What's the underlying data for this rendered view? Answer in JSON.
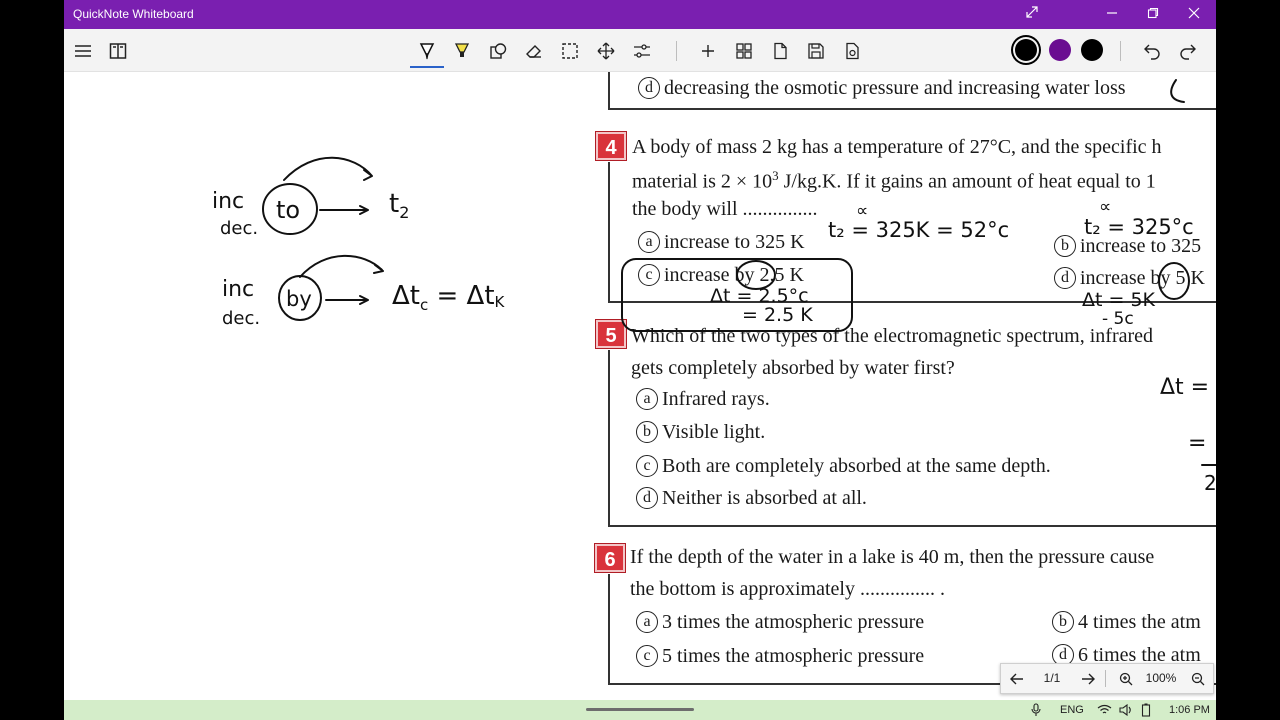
{
  "window": {
    "title": "QuickNote Whiteboard"
  },
  "toolbar": {
    "left_icons": [
      "hamburger-menu-icon",
      "book-icon"
    ],
    "tools": [
      "pen-icon",
      "highlighter-icon",
      "shape-icon",
      "eraser-icon",
      "lasso-select-icon",
      "move-icon",
      "adjust-icon"
    ],
    "actions": [
      "add-page-icon",
      "grid-icon",
      "page-icon",
      "save-icon",
      "export-icon"
    ],
    "active_tool": "pen",
    "pen_colors": [
      "#000000",
      "#6a0d91",
      "#000000"
    ],
    "history": [
      "undo-icon",
      "redo-icon"
    ]
  },
  "colors": {
    "titlebar": "#7a1fb0",
    "question_badge": "#d9333b",
    "taskbar": "#d4edc9"
  },
  "worksheet": {
    "prev_option": {
      "letter": "d",
      "text": "decreasing the osmotic pressure and increasing water loss"
    },
    "q4": {
      "number": "4",
      "line1": "A body of mass 2 kg has a temperature of 27°C, and the specific h",
      "line2_pre": "material is 2 × 10",
      "line2_sup": "3",
      "line2_post": " J/kg.K. If it gains an amount of heat equal to 1",
      "line3": "the body will ...............",
      "options": [
        {
          "letter": "a",
          "text": "increase to 325 K"
        },
        {
          "letter": "b",
          "text": "increase to 325"
        },
        {
          "letter": "c",
          "text": "increase by 2.5 K"
        },
        {
          "letter": "d",
          "text": "increase by 5 K"
        }
      ]
    },
    "q5": {
      "number": "5",
      "line1": "Which of the two types of the electromagnetic spectrum, infrared",
      "line2": "gets completely absorbed by water first?",
      "options": [
        {
          "letter": "a",
          "text": "Infrared rays."
        },
        {
          "letter": "b",
          "text": "Visible light."
        },
        {
          "letter": "c",
          "text": "Both are completely absorbed at the same depth."
        },
        {
          "letter": "d",
          "text": "Neither is absorbed at all."
        }
      ]
    },
    "q6": {
      "number": "6",
      "line1": "If the depth of the water in a lake is 40 m, then the pressure cause",
      "line2": "the bottom is approximately ............... .",
      "options": [
        {
          "letter": "a",
          "text": "3 times the atmospheric pressure"
        },
        {
          "letter": "b",
          "text": "4 times the atm"
        },
        {
          "letter": "c",
          "text": "5 times the atmospheric pressure"
        },
        {
          "letter": "d",
          "text": "6 times the atm"
        }
      ]
    }
  },
  "handwriting": {
    "left_top_inc": "inc",
    "left_top_dec": "dec.",
    "left_top_circled": "to",
    "left_top_target": "t",
    "left_top_target_sub": "2",
    "left_bottom_inc": "inc",
    "left_bottom_dec": "dec.",
    "left_bottom_circled": "by",
    "left_bottom_eq": "Δt",
    "left_bottom_eq_sub1": "c",
    "left_bottom_eq_mid": " = Δt",
    "left_bottom_eq_sub2": "K",
    "q4_a_note": "t₂ = 325K = 52°c",
    "q4_b_note": "t₂ = 325°c",
    "q4_c_note1": "Δt = 2.5°c",
    "q4_c_note2": "= 2.5 K",
    "q4_d_note1": "Δt = 5K",
    "q4_d_note2": "- 5c",
    "alpha_1": "∝",
    "alpha_2": "∝",
    "right_edge_1": "Δt =",
    "right_edge_2": "=",
    "right_edge_3": "2"
  },
  "pager": {
    "page": "1/1",
    "zoom": "100%"
  },
  "taskbar": {
    "language": "ENG",
    "time": "1:06 PM"
  }
}
